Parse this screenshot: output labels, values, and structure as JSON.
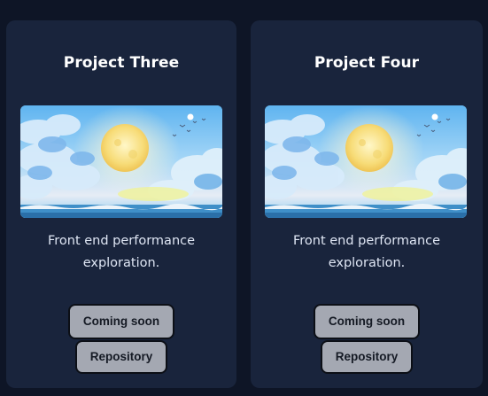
{
  "projects": [
    {
      "title": "Project Three",
      "description_line1": "Front end performance",
      "description_line2": "exploration.",
      "coming_soon_label": "Coming soon",
      "repository_label": "Repository",
      "image_alt": "anime-sky-moon-icon"
    },
    {
      "title": "Project Four",
      "description_line1": "Front end performance",
      "description_line2": "exploration.",
      "coming_soon_label": "Coming soon",
      "repository_label": "Repository",
      "image_alt": "anime-sky-moon-icon"
    }
  ],
  "colors": {
    "page_bg": "#0e1526",
    "card_bg": "#19243c",
    "button_bg": "#a4a8b2",
    "title_text": "#ffffff",
    "desc_text": "#dfe6f4"
  }
}
